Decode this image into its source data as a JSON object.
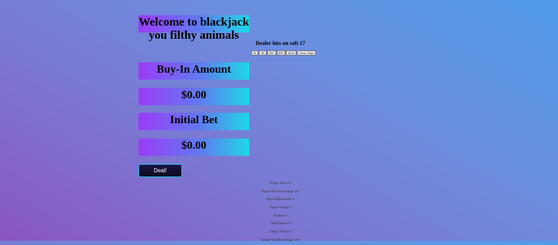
{
  "header": {
    "title": "Welcome to blackjack you filthy animals",
    "dealer_rule": "Dealer hits on soft 17"
  },
  "chips": {
    "buttons": [
      "$1",
      "$5",
      "$10",
      "$25",
      "$100",
      "Clear Chips"
    ]
  },
  "buy_in": {
    "label": "Buy-In Amount",
    "value": "$0.00"
  },
  "initial_bet": {
    "label": "Initial Bet",
    "value": "$0.00"
  },
  "actions": {
    "deal_label": "Deal!"
  },
  "stats": [
    "Player Wins: 0",
    "Player Win Percentage: 0%",
    "Player Blackjacks: 0",
    "Player Busts: 0",
    "Pushes: 0",
    "Total Hands: 0",
    "Dealer Wins: 0",
    "Dealer Win Percentage: 0%"
  ],
  "colors": {
    "banner_gradient": [
      "#9b3cf7",
      "#5f7af0",
      "#1ed8e6"
    ],
    "background_gradient": [
      "#8a55c4",
      "#4f9be8"
    ],
    "deal_button_bg": "#0b0a20",
    "deal_button_border": "#25c7e6"
  }
}
